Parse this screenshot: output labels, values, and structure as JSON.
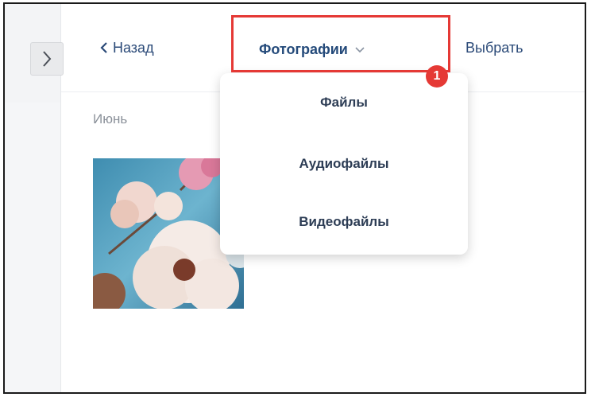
{
  "header": {
    "back_label": "Назад",
    "album_label": "Фотографии",
    "select_label": "Выбрать"
  },
  "callout": {
    "badge": "1",
    "color": "#e53935"
  },
  "gallery": {
    "section_label": "Июнь",
    "photo_icon": "flowers-photo"
  },
  "dropdown": {
    "items": [
      {
        "label": "Файлы"
      },
      {
        "label": "Аудиофайлы"
      },
      {
        "label": "Видеофайлы"
      }
    ]
  },
  "colors": {
    "accent": "#2b4a78",
    "highlight": "#e53935"
  }
}
